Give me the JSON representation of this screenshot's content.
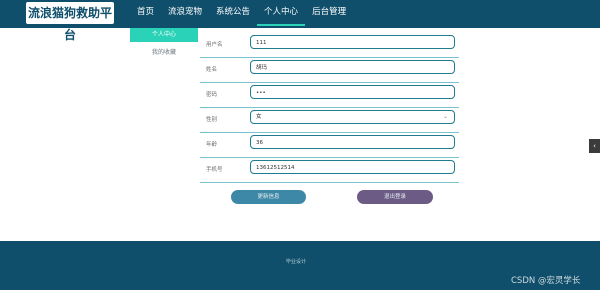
{
  "brand": "流浪猫狗救助平台",
  "nav": [
    "首页",
    "流浪宠物",
    "系统公告",
    "个人中心",
    "后台管理"
  ],
  "sidebar": {
    "items": [
      "个人中心",
      "我的收藏"
    ]
  },
  "form": {
    "username_label": "用户名",
    "username_value": "111",
    "name_label": "姓名",
    "name_value": "胡玛",
    "password_label": "密码",
    "password_value": "•••",
    "gender_label": "性别",
    "gender_value": "女",
    "age_label": "年龄",
    "age_value": "36",
    "phone_label": "手机号",
    "phone_value": "13612512514"
  },
  "buttons": {
    "update": "更新信息",
    "logout": "退出登录"
  },
  "footer_text": "毕业设计",
  "watermark": "CSDN @宏灵学长",
  "handle": "‹"
}
